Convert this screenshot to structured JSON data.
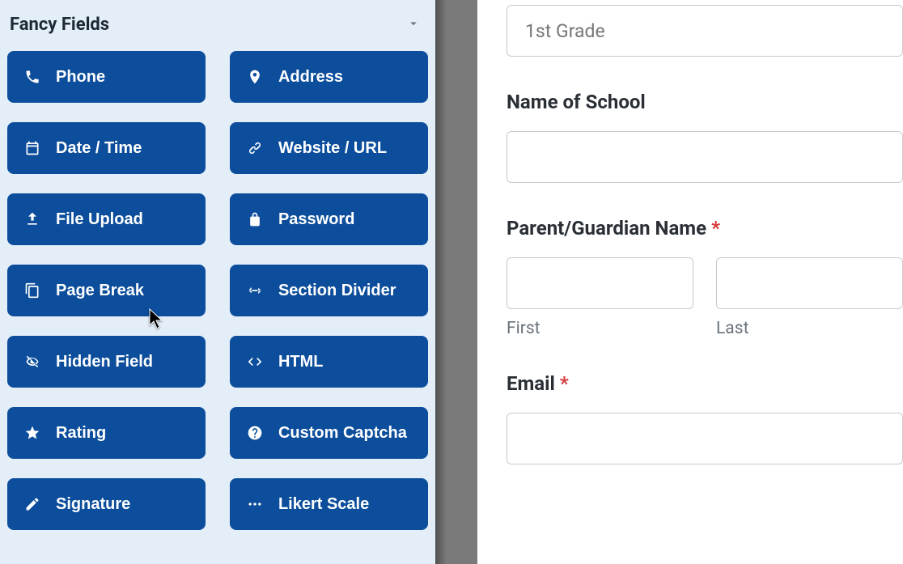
{
  "sidebar": {
    "section_title": "Fancy Fields",
    "fields": [
      {
        "label": "Phone",
        "icon": "phone-icon"
      },
      {
        "label": "Address",
        "icon": "map-pin-icon"
      },
      {
        "label": "Date / Time",
        "icon": "calendar-icon"
      },
      {
        "label": "Website / URL",
        "icon": "link-icon"
      },
      {
        "label": "File Upload",
        "icon": "upload-icon"
      },
      {
        "label": "Password",
        "icon": "lock-icon"
      },
      {
        "label": "Page Break",
        "icon": "copy-icon"
      },
      {
        "label": "Section Divider",
        "icon": "arrows-h-icon"
      },
      {
        "label": "Hidden Field",
        "icon": "eye-slash-icon"
      },
      {
        "label": "HTML",
        "icon": "code-icon"
      },
      {
        "label": "Rating",
        "icon": "star-icon"
      },
      {
        "label": "Custom Captcha",
        "icon": "help-icon"
      },
      {
        "label": "Signature",
        "icon": "pencil-icon"
      },
      {
        "label": "Likert Scale",
        "icon": "dots-icon"
      }
    ]
  },
  "preview": {
    "grade_placeholder": "1st Grade",
    "school_label": "Name of School",
    "parent_label": "Parent/Guardian Name",
    "required_mark": "*",
    "first_sublabel": "First",
    "last_sublabel": "Last",
    "email_label": "Email"
  }
}
